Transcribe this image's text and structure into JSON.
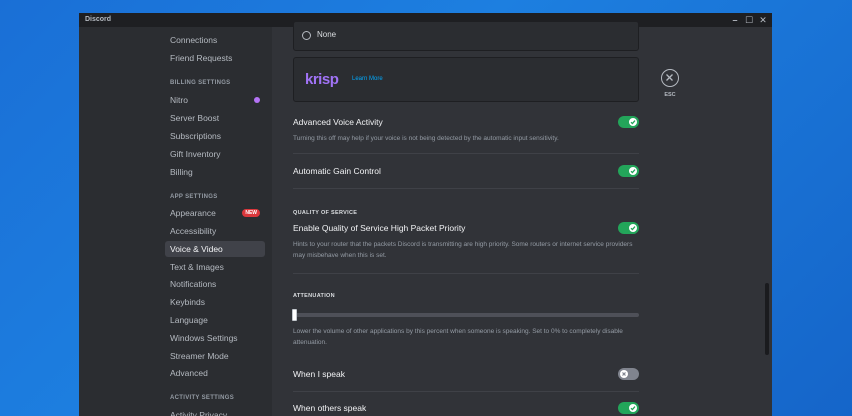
{
  "window": {
    "title": "Discord",
    "controls": [
      "–",
      "☐",
      "✕"
    ]
  },
  "sidebar": {
    "items": [
      {
        "label": "Connections"
      },
      {
        "label": "Friend Requests"
      }
    ],
    "billing_header": "BILLING SETTINGS",
    "billing_items": [
      {
        "label": "Nitro"
      },
      {
        "label": "Server Boost"
      },
      {
        "label": "Subscriptions"
      },
      {
        "label": "Gift Inventory"
      },
      {
        "label": "Billing"
      }
    ],
    "app_header": "APP SETTINGS",
    "app_items": [
      {
        "label": "Appearance",
        "badge": "NEW"
      },
      {
        "label": "Accessibility"
      },
      {
        "label": "Voice & Video",
        "active": true
      },
      {
        "label": "Text & Images"
      },
      {
        "label": "Notifications"
      },
      {
        "label": "Keybinds"
      },
      {
        "label": "Language"
      },
      {
        "label": "Windows Settings"
      },
      {
        "label": "Streamer Mode"
      },
      {
        "label": "Advanced"
      }
    ],
    "activity_header": "ACTIVITY SETTINGS",
    "activity_items": [
      {
        "label": "Activity Privacy"
      }
    ]
  },
  "content": {
    "none_option": "None",
    "krisp": {
      "logo": "krisp",
      "learn_more": "Learn More"
    },
    "advanced_voice": {
      "title": "Advanced Voice Activity",
      "desc": "Turning this off may help if your voice is not being detected by the automatic input sensitivity.",
      "enabled": true
    },
    "gain_control": {
      "title": "Automatic Gain Control",
      "enabled": true
    },
    "qos": {
      "header": "QUALITY OF SERVICE",
      "title": "Enable Quality of Service High Packet Priority",
      "desc": "Hints to your router that the packets Discord is transmitting are high priority. Some routers or internet service providers may misbehave when this is set.",
      "enabled": true
    },
    "attenuation": {
      "header": "ATTENUATION",
      "value_percent": 0,
      "desc": "Lower the volume of other applications by this percent when someone is speaking. Set to 0% to completely disable attenuation."
    },
    "when_i_speak": {
      "title": "When I speak",
      "enabled": false
    },
    "when_others_speak": {
      "title": "When others speak",
      "enabled": true
    }
  },
  "close": {
    "label": "ESC"
  },
  "colors": {
    "accent_green": "#23a55a",
    "krisp_purple": "#a173f6",
    "link_blue": "#00a8fc"
  }
}
